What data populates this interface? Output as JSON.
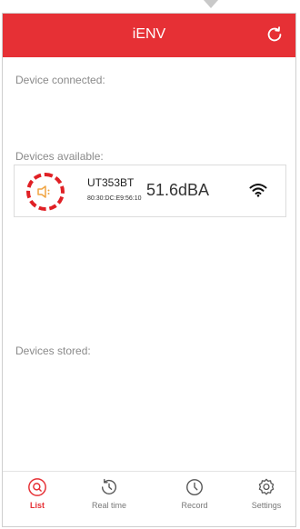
{
  "app": {
    "title": "iENV"
  },
  "sections": {
    "connected": "Device  connected:",
    "available": "Devices available:",
    "stored": "Devices stored:"
  },
  "device": {
    "name": "UT353BT",
    "mac": "80:30:DC:E9:56:10",
    "value": "51.6dBA",
    "icon": "speaker-icon",
    "signal_icon": "wifi-icon"
  },
  "tabs": [
    {
      "label": "List",
      "icon": "search-icon",
      "active": true
    },
    {
      "label": "Real time",
      "icon": "history-icon",
      "active": false
    },
    {
      "label": "Record",
      "icon": "clock-icon",
      "active": false
    },
    {
      "label": "Settings",
      "icon": "gear-icon",
      "active": false
    }
  ],
  "colors": {
    "accent": "#e63035",
    "highlight": "#e02025",
    "speaker": "#f0a440"
  }
}
